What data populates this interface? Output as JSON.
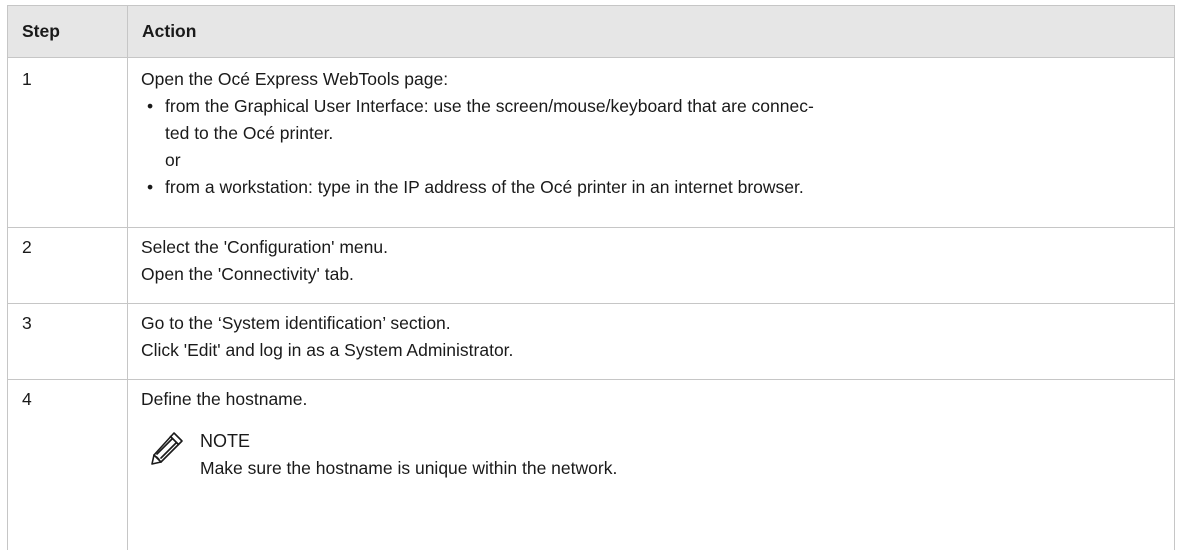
{
  "table": {
    "headers": {
      "step": "Step",
      "action": "Action"
    },
    "rows": [
      {
        "step": "1",
        "intro": "Open the Océ Express WebTools page:",
        "bullets": [
          {
            "lines": [
              "from the Graphical User Interface: use the screen/mouse/keyboard that are connec-",
              "ted to the Océ printer."
            ]
          },
          {
            "lines": [
              "from a workstation: type in the IP address of the Océ printer in an internet browser."
            ]
          }
        ],
        "or": "or"
      },
      {
        "step": "2",
        "lines": [
          "Select the 'Configuration' menu.",
          "Open the 'Connectivity' tab."
        ]
      },
      {
        "step": "3",
        "lines": [
          "Go to the ‘System identification’ section.",
          "Click 'Edit' and log in as a System Administrator."
        ]
      },
      {
        "step": "4",
        "lines": [
          "Define the hostname."
        ],
        "note": {
          "icon": "pencil-note-icon",
          "title": "NOTE",
          "text": "Make sure the hostname is unique within the network."
        }
      }
    ]
  }
}
